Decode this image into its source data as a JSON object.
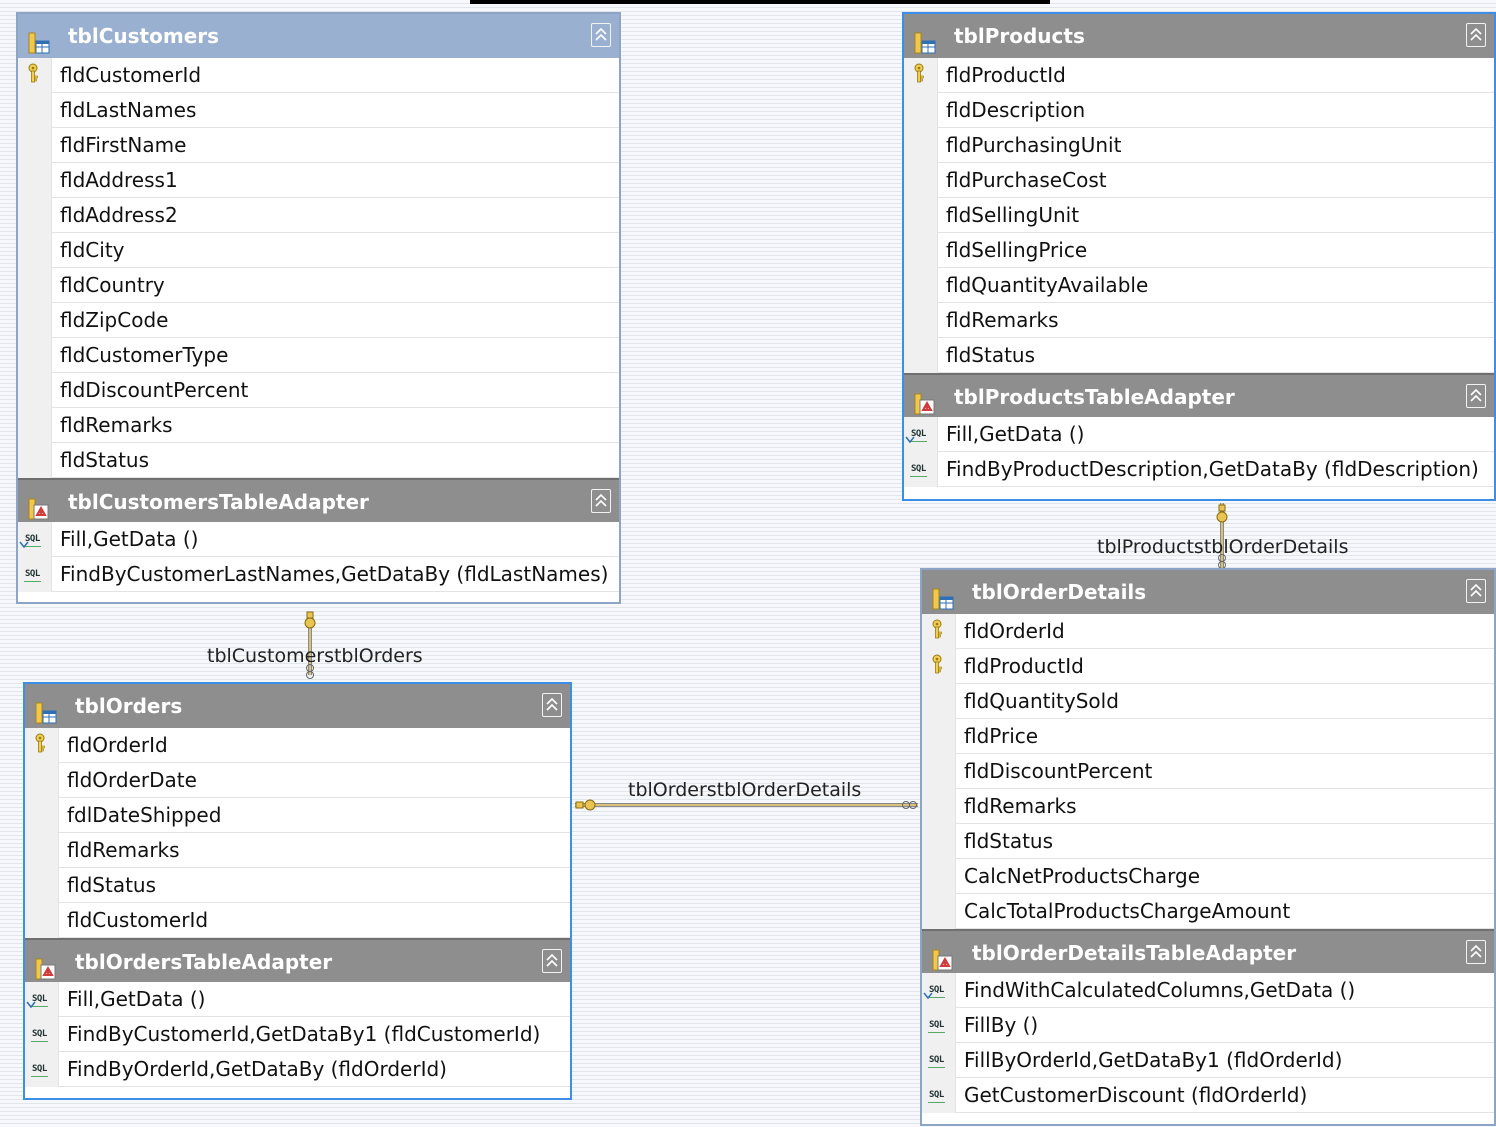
{
  "tables": {
    "customers": {
      "name": "tblCustomers",
      "fields": [
        "fldCustomerId",
        "fldLastNames",
        "fldFirstName",
        "fldAddress1",
        "fldAddress2",
        "fldCity",
        "fldCountry",
        "fldZipCode",
        "fldCustomerType",
        "fldDiscountPercent",
        "fldRemarks",
        "fldStatus"
      ],
      "key_fields": [
        "fldCustomerId"
      ],
      "adapter": {
        "name": "tblCustomersTableAdapter",
        "methods": [
          "Fill,GetData ()",
          "FindByCustomerLastNames,GetDataBy (fldLastNames)"
        ]
      }
    },
    "products": {
      "name": "tblProducts",
      "fields": [
        "fldProductId",
        "fldDescription",
        "fldPurchasingUnit",
        "fldPurchaseCost",
        "fldSellingUnit",
        "fldSellingPrice",
        "fldQuantityAvailable",
        "fldRemarks",
        "fldStatus"
      ],
      "key_fields": [
        "fldProductId"
      ],
      "adapter": {
        "name": "tblProductsTableAdapter",
        "methods": [
          "Fill,GetData ()",
          "FindByProductDescription,GetDataBy (fldDescription)"
        ]
      }
    },
    "orders": {
      "name": "tblOrders",
      "fields": [
        "fldOrderId",
        "fldOrderDate",
        "fdlDateShipped",
        "fldRemarks",
        "fldStatus",
        "fldCustomerId"
      ],
      "key_fields": [
        "fldOrderId"
      ],
      "adapter": {
        "name": "tblOrdersTableAdapter",
        "methods": [
          "Fill,GetData ()",
          "FindByCustomerId,GetDataBy1 (fldCustomerId)",
          "FindByOrderId,GetDataBy (fldOrderId)"
        ]
      }
    },
    "order_details": {
      "name": "tblOrderDetails",
      "fields": [
        "fldOrderId",
        "fldProductId",
        "fldQuantitySold",
        "fldPrice",
        "fldDiscountPercent",
        "fldRemarks",
        "fldStatus",
        "CalcNetProductsCharge",
        "CalcTotalProductsChargeAmount"
      ],
      "key_fields": [
        "fldOrderId",
        "fldProductId"
      ],
      "adapter": {
        "name": "tblOrderDetailsTableAdapter",
        "methods": [
          "FindWithCalculatedColumns,GetData ()",
          "FillBy ()",
          "FillByOrderId,GetDataBy1 (fldOrderId)",
          "GetCustomerDiscount (fldOrderId)"
        ]
      }
    }
  },
  "relations": [
    {
      "name": "tblCustomerstblOrders",
      "from": "tblCustomers",
      "to": "tblOrders"
    },
    {
      "name": "tblOrderstblOrderDetails",
      "from": "tblOrders",
      "to": "tblOrderDetails"
    },
    {
      "name": "tblProductstblOrderDetails",
      "from": "tblProducts",
      "to": "tblOrderDetails"
    }
  ],
  "icons": {
    "table": "table-icon",
    "adapter": "table-adapter-icon",
    "key": "key-icon",
    "query": "sql-query-icon",
    "collapse": "collapse-chevron-icon"
  },
  "colors": {
    "header_gray": "#8e8e8e",
    "header_blue": "#9ab0d0",
    "selected_border": "#3d8ee6",
    "relation_line": "#c7a84a"
  }
}
